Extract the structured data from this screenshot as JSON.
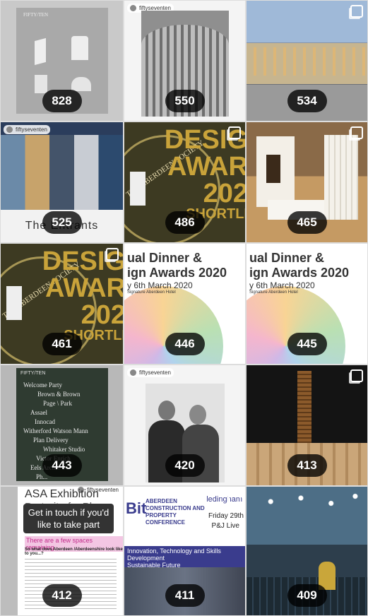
{
  "grid": {
    "tiles": [
      {
        "count": "828"
      },
      {
        "count": "550",
        "tag": "fiftyseventen"
      },
      {
        "count": "534"
      },
      {
        "count": "525",
        "tag": "fiftyseventen",
        "caption": "The Entrants"
      },
      {
        "count": "486",
        "poster": {
          "line1": "DESIG",
          "line2": "AWAR",
          "line3": "202",
          "line4": "SHORTLI",
          "seal": "THE ABERDEEN SOCIETY"
        }
      },
      {
        "count": "465"
      },
      {
        "count": "461",
        "poster": {
          "line1": "DESIG",
          "line2": "AWAR",
          "line3": "202",
          "line4": "SHORTLI",
          "seal": "THE ABERDEEN SOCIETY"
        }
      },
      {
        "count": "446",
        "event": {
          "line1": "ual Dinner &",
          "line2": "ign Awards 2020",
          "line3": "y 6th March 2020",
          "line4": "Signature Aberdeen Hotel"
        }
      },
      {
        "count": "445",
        "event": {
          "line1": "ual Dinner &",
          "line2": "ign Awards 2020",
          "line3": "y 6th March 2020",
          "line4": "Signature Aberdeen Hotel"
        }
      },
      {
        "count": "443",
        "list": {
          "title": "FIFTY/TEN",
          "items": [
            "Welcome Party",
            "Brown & Brown",
            "Page \\ Park",
            "Assael",
            "Innocad",
            "Witherford Watson Mann",
            "Plan Delivery",
            "Whitaker Studio",
            "Victor Enrich",
            "Eels Archer",
            "Ph..."
          ]
        }
      },
      {
        "count": "420",
        "tag": "fiftyseventen"
      },
      {
        "count": "413"
      },
      {
        "count": "412",
        "tag": "fiftyseventen",
        "header": "ASA Exhibition",
        "subheader": "Portrait of a Place",
        "bubble": "Get in touch if you'd like to take part",
        "remaining": "There are a few spaces remaining",
        "question": "So what does Aberdeen /Aberdeenshire look like to you...?"
      },
      {
        "count": "411",
        "conf": {
          "org": "ABERDEEN CONSTRUCTION AND PROPERTY CONFERENCE",
          "partner": "ledingham",
          "date1": "Friday 29th",
          "date2": "P&J Live",
          "theme1": "Innovation, Technology and Skills Development",
          "theme2": "Sustainable Future"
        }
      },
      {
        "count": "409"
      }
    ]
  },
  "colors": {
    "badge_bg": "#000000",
    "gold": "#c9a33a",
    "olive": "#5a5324",
    "blue_banner": "#3a3c8d",
    "green": "#2f3b31"
  }
}
